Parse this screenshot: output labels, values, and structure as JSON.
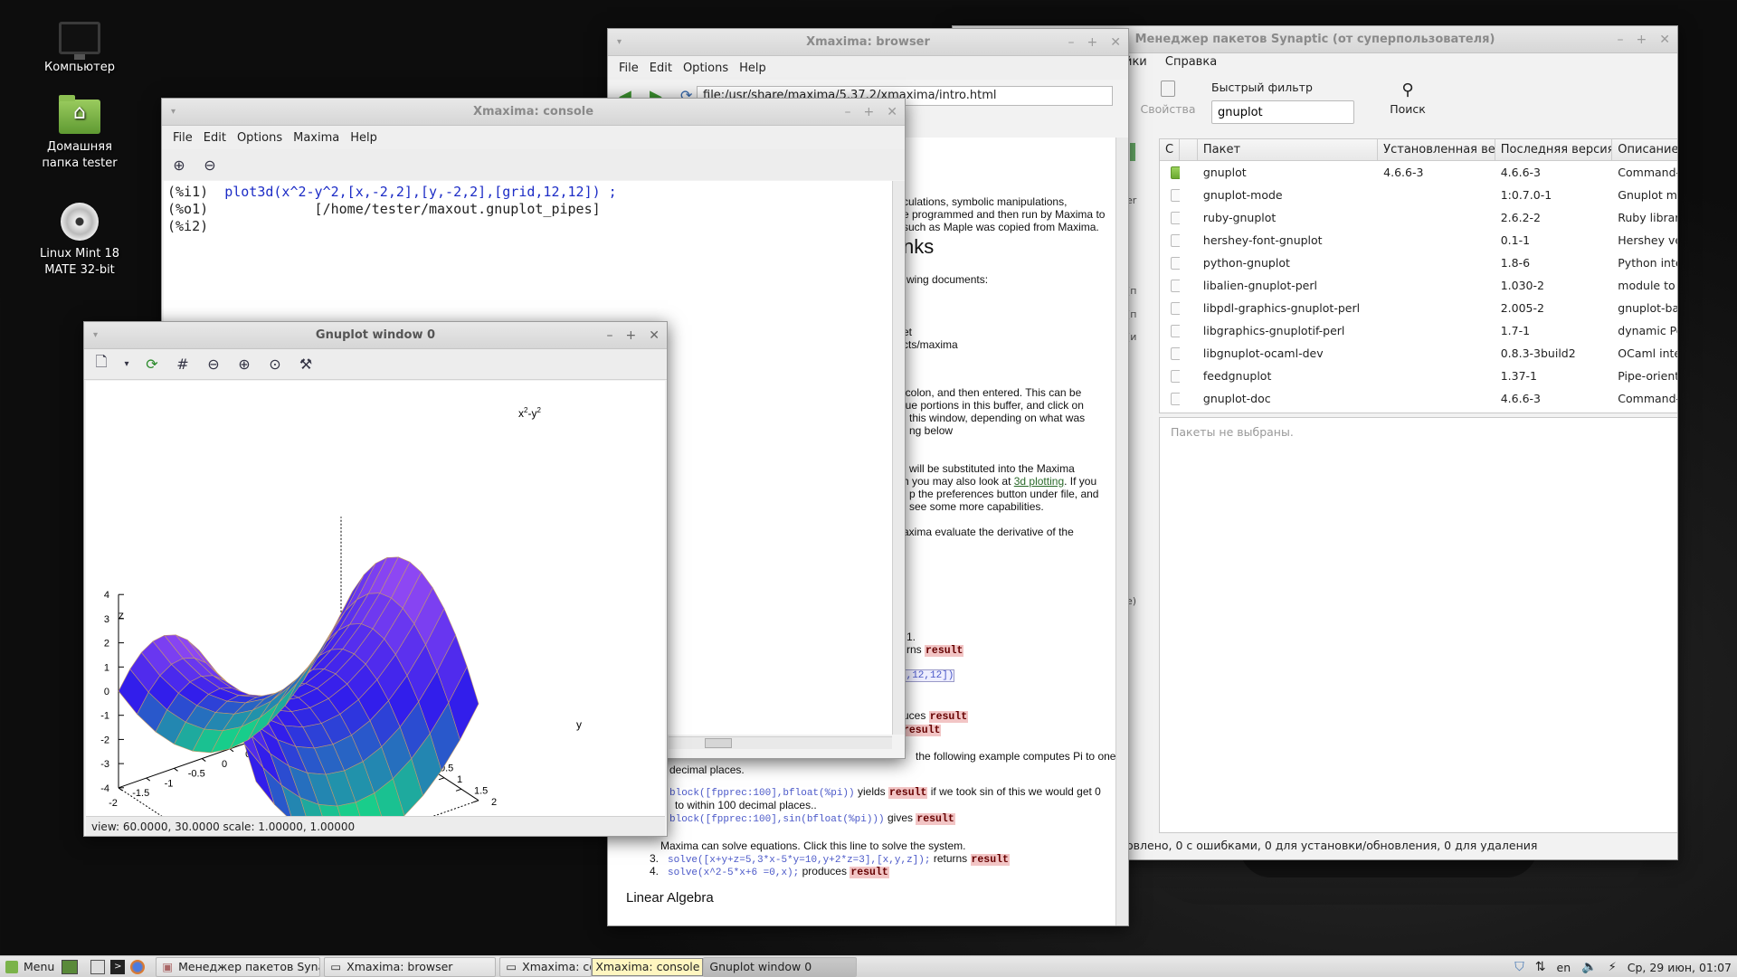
{
  "desktop": {
    "icons": [
      {
        "label": "Компьютер"
      },
      {
        "label": "Домашняя папка tester"
      },
      {
        "label": "Linux Mint 18 MATE 32-bit"
      }
    ]
  },
  "synaptic": {
    "title": "Менеджер пакетов Synaptic  (от суперпользователя)",
    "menu": [
      "йки",
      "Справка"
    ],
    "properties_label": "Свойства",
    "quick_filter_label": "Быстрый фильтр",
    "quick_filter_value": "gnuplot",
    "search_label": "Поиск",
    "columns": [
      "С",
      "Пакет",
      "Установленная верс",
      "Последняя версия",
      "Описание"
    ],
    "rows": [
      {
        "name": "gnuplot",
        "installed": "4.6.6-3",
        "latest": "4.6.6-3",
        "desc": "Command-lin",
        "is_installed": true
      },
      {
        "name": "gnuplot-mode",
        "installed": "",
        "latest": "1:0.7.0-1",
        "desc": "Gnuplot mode",
        "is_installed": false
      },
      {
        "name": "ruby-gnuplot",
        "installed": "",
        "latest": "2.6.2-2",
        "desc": "Ruby library t",
        "is_installed": false
      },
      {
        "name": "hershey-font-gnuplot",
        "installed": "",
        "latest": "0.1-1",
        "desc": "Hershey vect",
        "is_installed": false
      },
      {
        "name": "python-gnuplot",
        "installed": "",
        "latest": "1.8-6",
        "desc": "Python interfa",
        "is_installed": false
      },
      {
        "name": "libalien-gnuplot-perl",
        "installed": "",
        "latest": "1.030-2",
        "desc": "module to fin",
        "is_installed": false
      },
      {
        "name": "libpdl-graphics-gnuplot-perl",
        "installed": "",
        "latest": "2.005-2",
        "desc": "gnuplot-base",
        "is_installed": false
      },
      {
        "name": "libgraphics-gnuplotif-perl",
        "installed": "",
        "latest": "1.7-1",
        "desc": "dynamic Perl",
        "is_installed": false
      },
      {
        "name": "libgnuplot-ocaml-dev",
        "installed": "",
        "latest": "0.8.3-3build2",
        "desc": "OCaml interfa",
        "is_installed": false
      },
      {
        "name": "feedgnuplot",
        "installed": "",
        "latest": "1.37-1",
        "desc": "Pipe-oriented",
        "is_installed": false
      },
      {
        "name": "gnuplot-doc",
        "installed": "",
        "latest": "4.6.6-3",
        "desc": "Command-lin",
        "is_installed": false
      }
    ],
    "no_selection": "Пакеты не выбраны.",
    "status": "овлено, 0 с ошибками, 0 для установки/обновления, 0 для удаления",
    "side_letters": [
      "er",
      "(п",
      "(п",
      "(и",
      "е)"
    ]
  },
  "browser": {
    "title": "Xmaxima: browser",
    "menu": [
      "File",
      "Edit",
      "Options",
      "Help"
    ],
    "address": "file:/usr/share/maxima/5.37.2/xmaxima/intro.html",
    "lines": {
      "l1": "culations, symbolic manipulations,",
      "l2": "e programmed and then run by Maxima to",
      "l3": "such as Maple was copied from Maxima.",
      "heading": "nks",
      "l4": "wing documents:",
      "l5": "et",
      "l6": "cts/maxima",
      "l7": "icolon, and then entered. This can be",
      "l8": "lue portions in this buffer, and click on",
      "l9": "this window, depending on what was",
      "l10": "ng below",
      "l11": "will be substituted into the Maxima",
      "l12a": "h you may also look at ",
      "l12link": "3d plotting",
      "l12b": ". If you",
      "l13": "p the preferences button under file, and",
      "l14": "see some more capabilities.",
      "l15": "axima evaluate the derivative of the",
      "l16": "1.",
      "l17": "rns",
      "l18": "d,12,12])",
      "l19": "uces",
      "l20": "the following example computes Pi to one",
      "l21": "decimal places.",
      "code1": "block([fpprec:100],bfloat(%pi))",
      "l22": " yields ",
      "l22b": " if we took sin of this we would get 0",
      "l23": "to within 100 decimal places..",
      "code2": "block([fpprec:100],sin(bfloat(%pi)))",
      "l24": " gives ",
      "l25": "Maxima can solve equations. Click this line to solve the system.",
      "n3": "3.",
      "code3": "solve([x+y+z=5,3*x-5*y=10,y+2*z=3],[x,y,z]);",
      "l26": " returns ",
      "n4": "4.",
      "code4": "solve(x^2-5*x+6 =0,x);",
      "l27": " produces ",
      "heading2": "Linear Algebra",
      "result": "result"
    }
  },
  "console": {
    "title": "Xmaxima: console",
    "menu": [
      "File",
      "Edit",
      "Options",
      "Maxima",
      "Help"
    ],
    "lines": [
      {
        "label": "(%i1)",
        "text": "plot3d(x^2-y^2,[x,-2,2],[y,-2,2],[grid,12,12]) ;"
      },
      {
        "label": "(%o1)",
        "text": "             [/home/tester/maxout.gnuplot_pipes]"
      },
      {
        "label": "(%i2)",
        "text": ""
      }
    ]
  },
  "gnuplot": {
    "title": "Gnuplot window 0",
    "status": "view: 60.0000,  30.0000   scale: 1.00000,  1.00000",
    "plot_title_base": "x",
    "plot_title_mid": "-y",
    "plot_title_exp": "2",
    "z_label": "z",
    "x_label": "x",
    "y_label": "y",
    "z_ticks": [
      "4",
      "3",
      "2",
      "1",
      "0",
      "-1",
      "-2",
      "-3",
      "-4"
    ],
    "x_ticks": [
      "-2",
      "-1.5",
      "-1",
      "-0.5",
      "0",
      "0.5",
      "1",
      "1.5",
      "2"
    ],
    "y_ticks": [
      "-2",
      "-1.5",
      "-1",
      "-0.5",
      "0",
      "0.5",
      "1",
      "1.5",
      "2"
    ]
  },
  "chart_data": {
    "type": "surface",
    "function": "x^2-y^2",
    "x_range": [
      -2,
      2
    ],
    "y_range": [
      -2,
      2
    ],
    "z_range": [
      -4,
      4
    ],
    "grid": [
      12,
      12
    ],
    "view": [
      60,
      30
    ],
    "title": "x2-y2",
    "xlabel": "x",
    "ylabel": "y",
    "zlabel": "z"
  },
  "taskbar": {
    "menu_label": "Menu",
    "tasks": [
      "Менеджер пакетов Syna...",
      "Xmaxima: browser",
      "Xmaxima: con",
      "Gnuplot window 0"
    ],
    "tooltip": "Xmaxima: console",
    "lang": "en",
    "clock": "Ср, 29 июн, 01:07"
  }
}
